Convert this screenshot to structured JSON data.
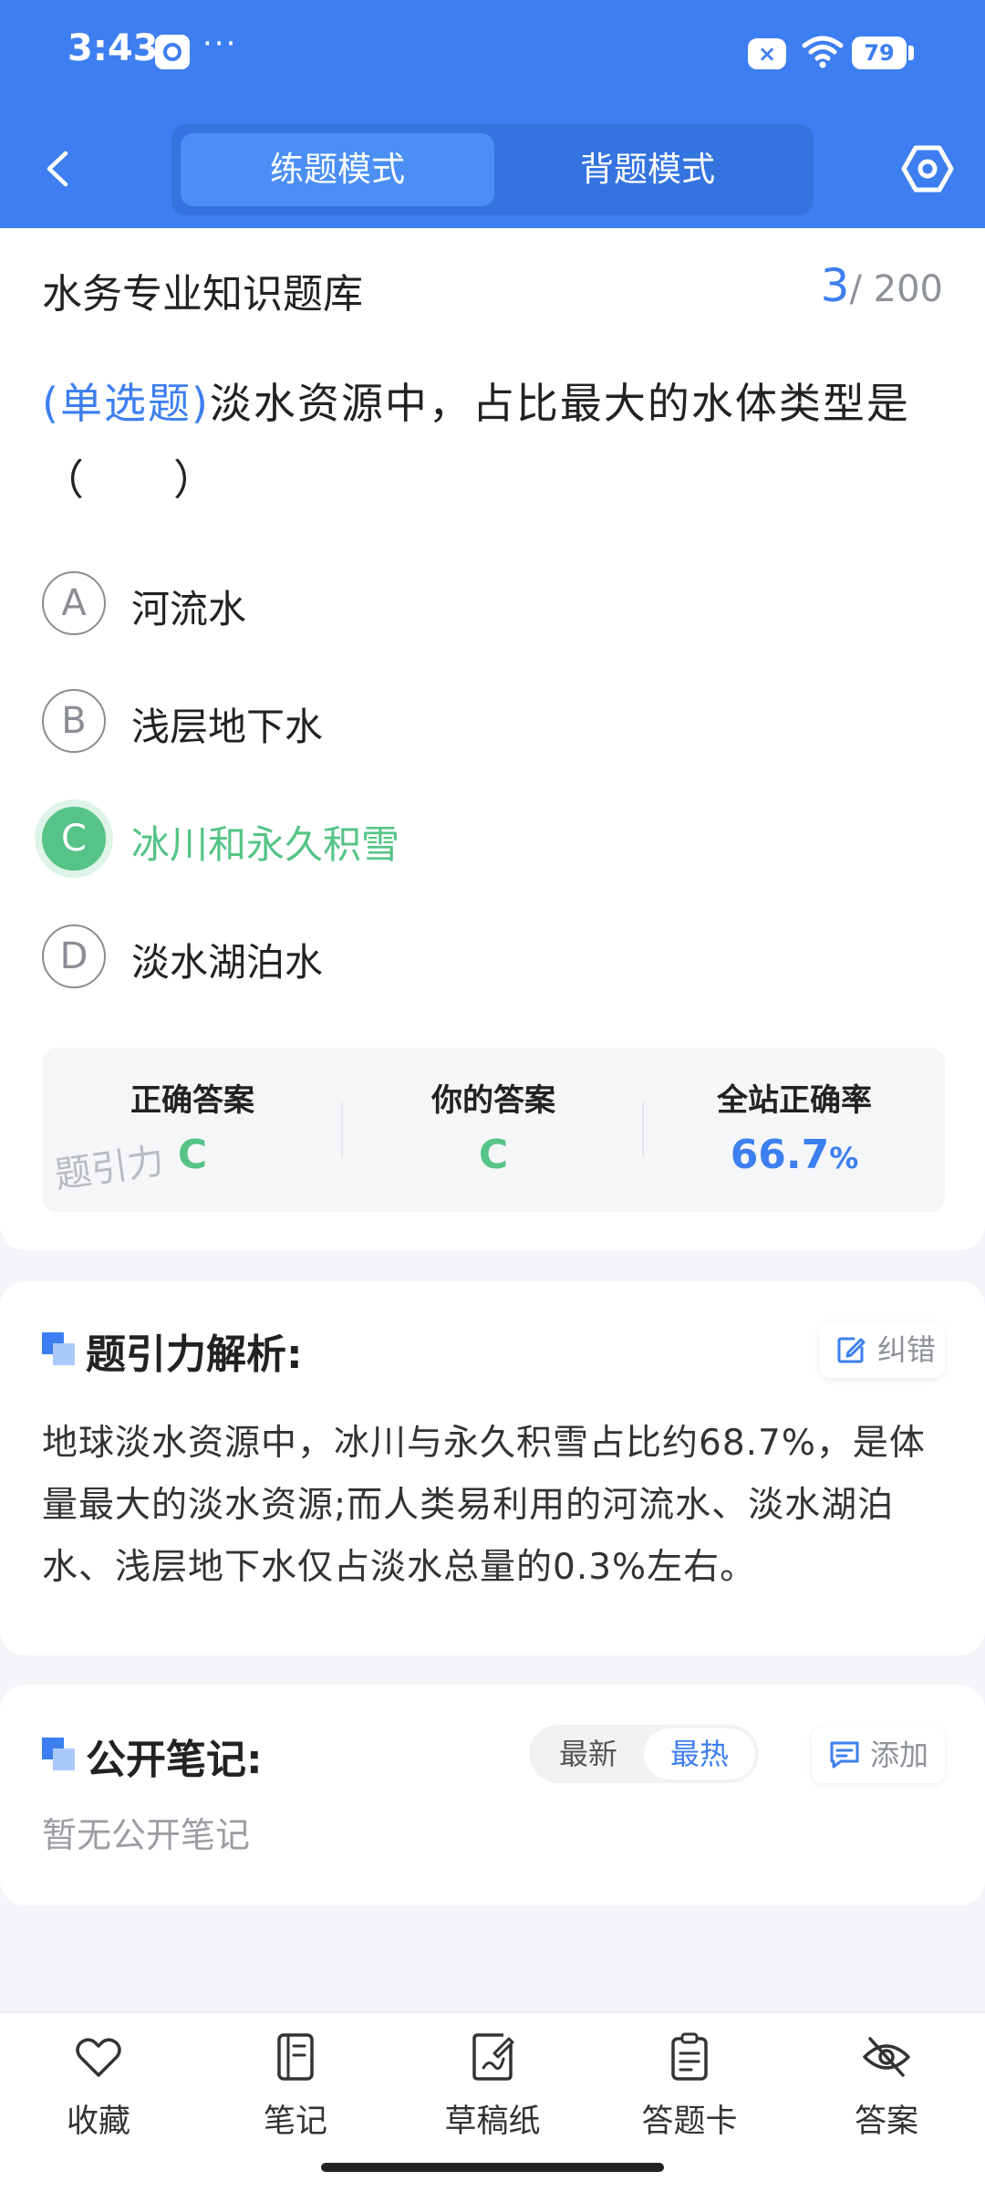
{
  "status_bar": {
    "time": "3:43",
    "dots": "···",
    "battery": "79",
    "x_label": "×"
  },
  "header": {
    "tabs": [
      {
        "label": "练题模式",
        "active": true
      },
      {
        "label": "背题模式",
        "active": false
      }
    ]
  },
  "title_bar": {
    "title": "水务专业知识题库",
    "current": "3",
    "total": "/ 200"
  },
  "question": {
    "type_label": "(单选题)",
    "text": "淡水资源中，占比最大的水体类型是（　　）",
    "options": [
      {
        "letter": "A",
        "text": "河流水",
        "state": "normal"
      },
      {
        "letter": "B",
        "text": "浅层地下水",
        "state": "normal"
      },
      {
        "letter": "C",
        "text": "冰川和永久积雪",
        "state": "correct"
      },
      {
        "letter": "D",
        "text": "淡水湖泊水",
        "state": "normal"
      }
    ]
  },
  "stats": {
    "correct_label": "正确答案",
    "correct_value": "C",
    "yours_label": "你的答案",
    "yours_value": "C",
    "rate_label": "全站正确率",
    "rate_value": "66.7",
    "rate_unit": "%",
    "watermark": "题引力"
  },
  "analysis": {
    "title": "题引力解析:",
    "report_label": "纠错",
    "text": "地球淡水资源中，冰川与永久积雪占比约68.7%，是体量最大的淡水资源;而人类易利用的河流水、淡水湖泊水、浅层地下水仅占淡水总量的0.3%左右。"
  },
  "notes": {
    "title": "公开笔记:",
    "sort_newest": "最新",
    "sort_hottest": "最热",
    "add_label": "添加",
    "empty_text": "暂无公开笔记"
  },
  "bottom_nav": [
    {
      "label": "收藏",
      "icon": "heart-icon"
    },
    {
      "label": "笔记",
      "icon": "notebook-icon"
    },
    {
      "label": "草稿纸",
      "icon": "draft-paper-icon"
    },
    {
      "label": "答题卡",
      "icon": "answer-sheet-icon"
    },
    {
      "label": "答案",
      "icon": "eye-off-icon"
    }
  ],
  "colors": {
    "primary": "#3d7ff0",
    "correct": "#55c486"
  }
}
